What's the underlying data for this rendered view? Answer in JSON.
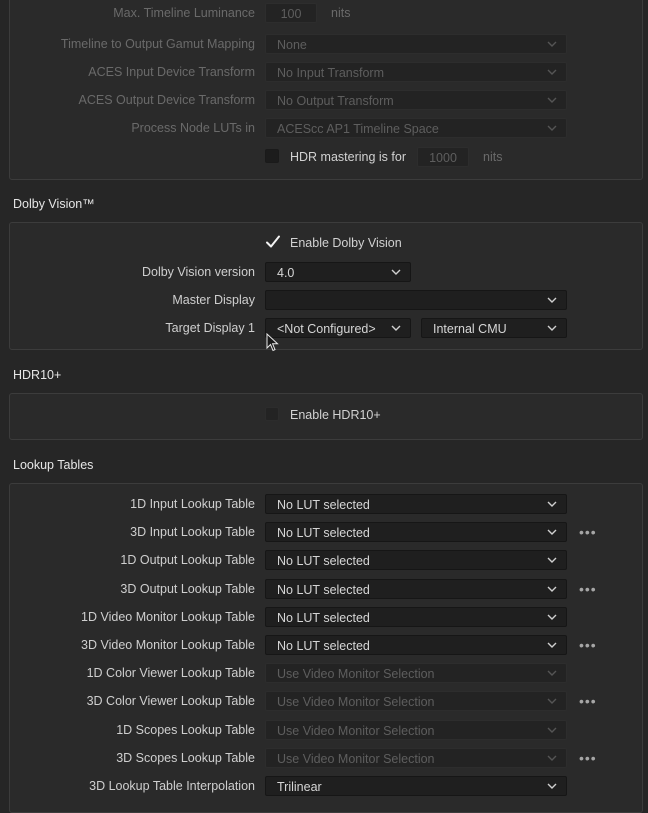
{
  "color_management": {
    "max_luminance": {
      "label": "Max. Timeline Luminance",
      "value": "100",
      "unit": "nits"
    },
    "gamut_mapping": {
      "label": "Timeline to Output Gamut Mapping",
      "value": "None"
    },
    "aces_idt": {
      "label": "ACES Input Device Transform",
      "value": "No Input Transform"
    },
    "aces_odt": {
      "label": "ACES Output Device Transform",
      "value": "No Output Transform"
    },
    "node_luts": {
      "label": "Process Node LUTs in",
      "value": "ACEScc AP1 Timeline Space"
    },
    "hdr_mastering": {
      "label": "HDR mastering is for",
      "value": "1000",
      "unit": "nits",
      "checked": false
    }
  },
  "dolby": {
    "title": "Dolby Vision™",
    "enable_label": "Enable Dolby Vision",
    "enabled": true,
    "version_label": "Dolby Vision version",
    "version_value": "4.0",
    "master_label": "Master Display",
    "master_value": "",
    "target_label": "Target Display 1",
    "target_value": "<Not Configured>",
    "cmu_value": "Internal CMU"
  },
  "hdr10": {
    "title": "HDR10+",
    "enable_label": "Enable HDR10+",
    "enabled": false
  },
  "lut": {
    "title": "Lookup Tables",
    "rows": [
      {
        "label": "1D Input Lookup Table",
        "value": "No LUT selected",
        "dots": false,
        "dim": false
      },
      {
        "label": "3D Input Lookup Table",
        "value": "No LUT selected",
        "dots": true,
        "dim": false
      },
      {
        "label": "1D Output Lookup Table",
        "value": "No LUT selected",
        "dots": false,
        "dim": false
      },
      {
        "label": "3D Output Lookup Table",
        "value": "No LUT selected",
        "dots": true,
        "dim": false
      },
      {
        "label": "1D Video Monitor Lookup Table",
        "value": "No LUT selected",
        "dots": false,
        "dim": false
      },
      {
        "label": "3D Video Monitor Lookup Table",
        "value": "No LUT selected",
        "dots": true,
        "dim": false
      },
      {
        "label": "1D Color Viewer Lookup Table",
        "value": "Use Video Monitor Selection",
        "dots": false,
        "dim": true
      },
      {
        "label": "3D Color Viewer Lookup Table",
        "value": "Use Video Monitor Selection",
        "dots": true,
        "dim": true
      },
      {
        "label": "1D Scopes Lookup Table",
        "value": "Use Video Monitor Selection",
        "dots": false,
        "dim": true
      },
      {
        "label": "3D Scopes Lookup Table",
        "value": "Use Video Monitor Selection",
        "dots": true,
        "dim": true
      },
      {
        "label": "3D Lookup Table Interpolation",
        "value": "Trilinear",
        "dots": false,
        "dim": false
      }
    ],
    "more_glyph": "•••"
  }
}
